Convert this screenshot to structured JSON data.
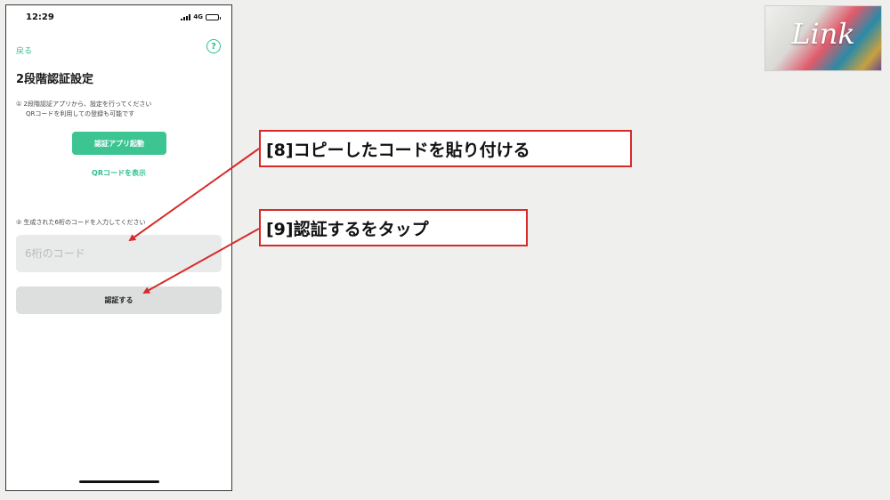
{
  "status_bar": {
    "time": "12:29",
    "network": "4G"
  },
  "screen": {
    "back_label": "戻る",
    "help_icon": "?",
    "title": "2段階認証設定",
    "step1_line1": "① 2段階認証アプリから、設定を行ってください",
    "step1_line2": "QRコードを利用しての登録も可能です",
    "auth_app_button": "認証アプリ起動",
    "qr_link": "QRコードを表示",
    "step2_text": "② 生成された6桁のコードを入力してください",
    "code_input_placeholder": "6桁のコード",
    "verify_button": "認証する"
  },
  "callouts": {
    "step8": "[8]コピーしたコードを貼り付ける",
    "step9": "[9]認証するをタップ"
  },
  "logo": {
    "text": "Link"
  },
  "colors": {
    "accent": "#3cc492",
    "callout_border": "#d92a2a",
    "arrow": "#d92a2a"
  }
}
